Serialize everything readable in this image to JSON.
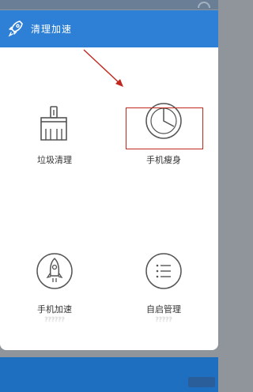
{
  "header": {
    "title": "清理加速",
    "icon": "rocket-icon"
  },
  "tiles": [
    {
      "id": "junk-clean",
      "label": "垃圾清理",
      "icon": "broom-icon"
    },
    {
      "id": "phone-slim",
      "label": "手机瘦身",
      "icon": "pie-chart-icon",
      "highlighted": true
    },
    {
      "id": "phone-boost",
      "label": "手机加速",
      "sub": "??????",
      "icon": "rocket-circle-icon"
    },
    {
      "id": "autostart",
      "label": "自启管理",
      "sub": "?????",
      "icon": "list-circle-icon"
    }
  ],
  "colors": {
    "header": "#2e7fd6",
    "highlight": "#c0281e",
    "backdrop": "#8f959b"
  },
  "watermark": {
    "text": ""
  }
}
